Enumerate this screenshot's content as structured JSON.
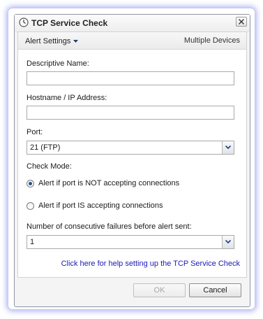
{
  "window": {
    "title": "TCP Service Check",
    "icon": "clock-icon",
    "close_icon": "close-icon"
  },
  "header": {
    "alert_settings_label": "Alert Settings",
    "multiple_devices_label": "Multiple Devices"
  },
  "form": {
    "descriptive_name": {
      "label": "Descriptive Name:",
      "value": ""
    },
    "hostname": {
      "label": "Hostname / IP Address:",
      "value": ""
    },
    "port": {
      "label": "Port:",
      "selected": "21 (FTP)"
    },
    "check_mode": {
      "label": "Check Mode:",
      "options": [
        {
          "label": "Alert if port is NOT accepting connections",
          "checked": true
        },
        {
          "label": "Alert if port IS accepting connections",
          "checked": false
        }
      ]
    },
    "failures": {
      "label": "Number of consecutive failures before alert sent:",
      "selected": "1"
    }
  },
  "help_link": "Click here for help setting up the TCP Service Check",
  "buttons": {
    "ok_label": "OK",
    "ok_enabled": false,
    "cancel_label": "Cancel"
  },
  "colors": {
    "link": "#1a1ab4",
    "glow": "#6e78e6"
  }
}
